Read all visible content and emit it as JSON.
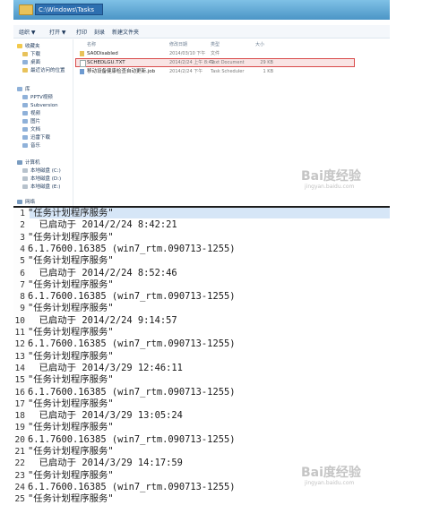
{
  "explorer": {
    "address": "C:\\Windows\\Tasks",
    "toolbar": [
      "组织 ▼",
      "打开 ▼",
      "打印",
      "刻录",
      "新建文件夹"
    ],
    "nav": {
      "favorites": "收藏夹",
      "favorites_items": [
        "下载",
        "桌面",
        "最近访问的位置"
      ],
      "libraries": "库",
      "libraries_items": [
        "PPTV视频",
        "Subversion",
        "视频",
        "图片",
        "文档",
        "迅雷下载",
        "音乐"
      ],
      "computer": "计算机",
      "drives": [
        "本地磁盘 (C:)",
        "本地磁盘 (D:)",
        "本地磁盘 (E:)"
      ],
      "network": "网络"
    },
    "columns": [
      "名称",
      "修改日期",
      "类型",
      "大小"
    ],
    "files": [
      {
        "name": "SA0Disabled",
        "date": "2014/03/10 下午",
        "type": "文件",
        "size": ""
      },
      {
        "name": "SCHEDLGU.TXT",
        "date": "2014/2/24 上午 8:42",
        "type": "Text Document",
        "size": "29 KB"
      },
      {
        "name": "移动设备健康检查自动更新.job",
        "date": "2014/2/24 下午",
        "type": "Task Scheduler",
        "size": "1 KB"
      }
    ]
  },
  "editor": {
    "lines": [
      "\"任务计划程序服务\"",
      "  已启动于 2014/2/24 8:42:21",
      "\"任务计划程序服务\"",
      "6.1.7600.16385 (win7_rtm.090713-1255)",
      "\"任务计划程序服务\"",
      "  已启动于 2014/2/24 8:52:46",
      "\"任务计划程序服务\"",
      "6.1.7600.16385 (win7_rtm.090713-1255)",
      "\"任务计划程序服务\"",
      "  已启动于 2014/2/24 9:14:57",
      "\"任务计划程序服务\"",
      "6.1.7600.16385 (win7_rtm.090713-1255)",
      "\"任务计划程序服务\"",
      "  已启动于 2014/3/29 12:46:11",
      "\"任务计划程序服务\"",
      "6.1.7600.16385 (win7_rtm.090713-1255)",
      "\"任务计划程序服务\"",
      "  已启动于 2014/3/29 13:05:24",
      "\"任务计划程序服务\"",
      "6.1.7600.16385 (win7_rtm.090713-1255)",
      "\"任务计划程序服务\"",
      "  已启动于 2014/3/29 14:17:59",
      "\"任务计划程序服务\"",
      "6.1.7600.16385 (win7_rtm.090713-1255)",
      "\"任务计划程序服务\""
    ],
    "line_numbers": [
      "1",
      "2",
      "3",
      "4",
      "5",
      "6",
      "7",
      "8",
      "9",
      "10",
      "11",
      "12",
      "13",
      "14",
      "15",
      "16",
      "17",
      "18",
      "19",
      "20",
      "21",
      "22",
      "23",
      "24",
      "25"
    ]
  },
  "watermark": {
    "text": "Bai度经验",
    "sub": "jingyan.baidu.com"
  }
}
